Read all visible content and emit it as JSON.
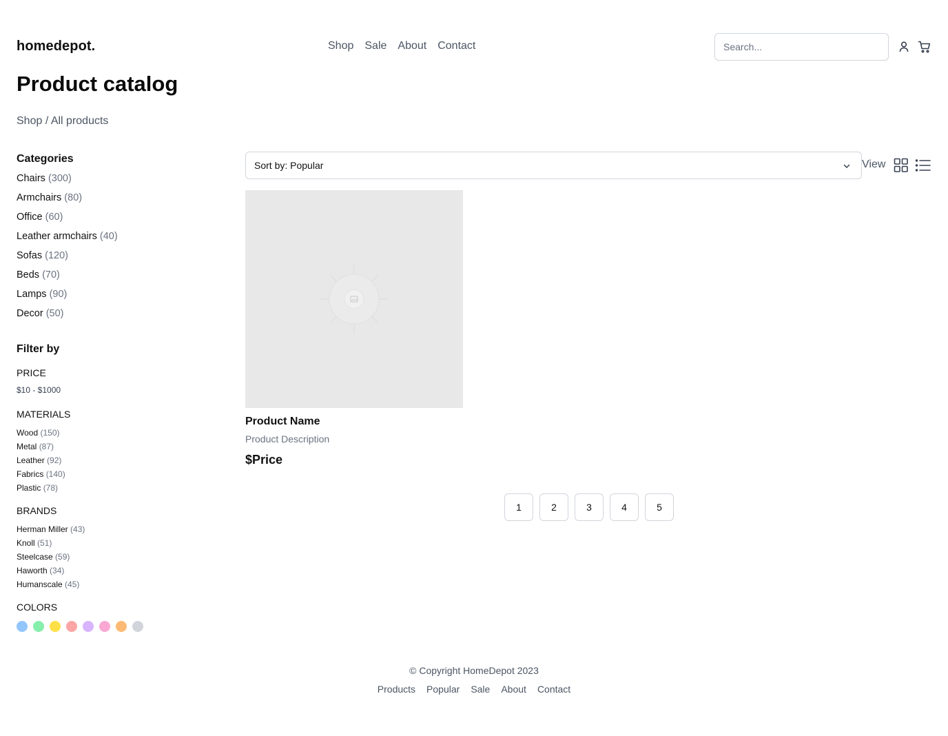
{
  "header": {
    "logo": "homedepot.",
    "nav": [
      "Shop",
      "Sale",
      "About",
      "Contact"
    ],
    "search_placeholder": "Search...",
    "icons": [
      "user-icon",
      "cart-icon"
    ]
  },
  "page": {
    "title": "Product catalog",
    "breadcrumb": "Shop / All products"
  },
  "sidebar": {
    "categories_heading": "Categories",
    "categories": [
      {
        "label": "Chairs",
        "count": "(300)"
      },
      {
        "label": "Armchairs",
        "count": "(80)"
      },
      {
        "label": "Office",
        "count": "(60)"
      },
      {
        "label": "Leather armchairs",
        "count": "(40)"
      },
      {
        "label": "Sofas",
        "count": "(120)"
      },
      {
        "label": "Beds",
        "count": "(70)"
      },
      {
        "label": "Lamps",
        "count": "(90)"
      },
      {
        "label": "Decor",
        "count": "(50)"
      }
    ],
    "filter_heading": "Filter by",
    "price": {
      "heading": "PRICE",
      "range": "$10 - $1000"
    },
    "materials": {
      "heading": "MATERIALS",
      "items": [
        {
          "label": "Wood",
          "count": "(150)"
        },
        {
          "label": "Metal",
          "count": "(87)"
        },
        {
          "label": "Leather",
          "count": "(92)"
        },
        {
          "label": "Fabrics",
          "count": "(140)"
        },
        {
          "label": "Plastic",
          "count": "(78)"
        }
      ]
    },
    "brands": {
      "heading": "BRANDS",
      "items": [
        {
          "label": "Herman Miller",
          "count": "(43)"
        },
        {
          "label": "Knoll",
          "count": "(51)"
        },
        {
          "label": "Steelcase",
          "count": "(59)"
        },
        {
          "label": "Haworth",
          "count": "(34)"
        },
        {
          "label": "Humanscale",
          "count": "(45)"
        }
      ]
    },
    "colors": {
      "heading": "COLORS",
      "swatches": [
        "#93c5fd",
        "#86efac",
        "#fde047",
        "#fca5a5",
        "#d8b4fe",
        "#f9a8d4",
        "#fdba74",
        "#d1d5db"
      ]
    }
  },
  "toolbar": {
    "sort_label": "Sort by: Popular",
    "view_label": "View",
    "icons": [
      "grid-view-icon",
      "list-view-icon"
    ]
  },
  "products": [
    {
      "name": "Product Name",
      "description": "Product Description",
      "price": "$Price"
    }
  ],
  "pagination": [
    "1",
    "2",
    "3",
    "4",
    "5"
  ],
  "footer": {
    "copyright": "© Copyright HomeDepot 2023",
    "links": [
      "Products",
      "Popular",
      "Sale",
      "About",
      "Contact"
    ]
  }
}
